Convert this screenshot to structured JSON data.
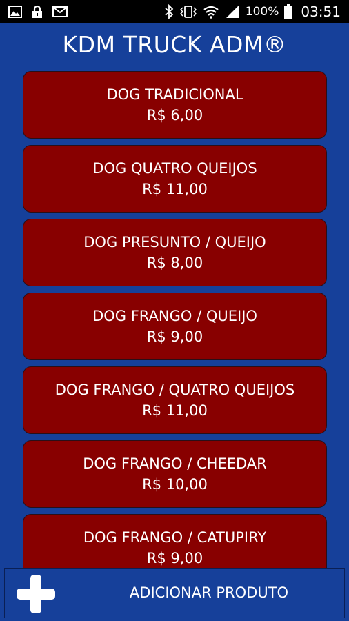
{
  "status_bar": {
    "battery": "100%",
    "time": "03:51",
    "icons": [
      "gallery-icon",
      "lock-icon",
      "mail-icon",
      "bluetooth-icon",
      "vibrate-icon",
      "wifi-icon",
      "signal-icon",
      "battery-icon"
    ]
  },
  "header": {
    "title": "KDM TRUCK ADM®"
  },
  "products": [
    {
      "name": "DOG TRADICIONAL",
      "price": "R$ 6,00"
    },
    {
      "name": "DOG QUATRO QUEIJOS",
      "price": "R$ 11,00"
    },
    {
      "name": "DOG PRESUNTO / QUEIJO",
      "price": "R$ 8,00"
    },
    {
      "name": "DOG FRANGO / QUEIJO",
      "price": "R$ 9,00"
    },
    {
      "name": "DOG FRANGO / QUATRO QUEIJOS",
      "price": "R$ 11,00"
    },
    {
      "name": "DOG FRANGO / CHEEDAR",
      "price": "R$ 10,00"
    },
    {
      "name": "DOG FRANGO / CATUPIRY",
      "price": "R$ 9,00"
    }
  ],
  "footer": {
    "add_label": "ADICIONAR PRODUTO",
    "add_icon": "plus-icon"
  },
  "colors": {
    "background": "#16409a",
    "card": "#880000",
    "status_bar": "#000000",
    "text": "#ffffff"
  }
}
